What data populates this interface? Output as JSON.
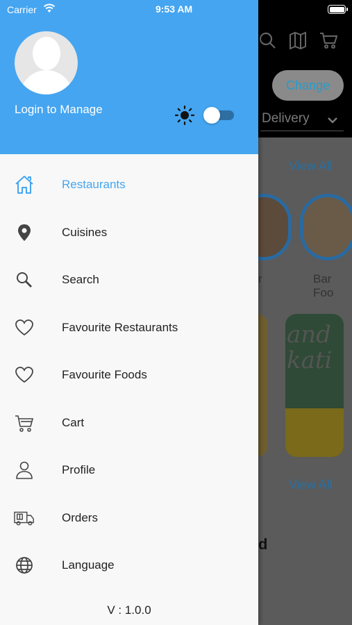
{
  "status_bar": {
    "carrier": "Carrier",
    "time": "9:53 AM"
  },
  "background": {
    "change_button": "Change",
    "delivery": "Delivery",
    "view_all": "View All",
    "label_partial_1": "r",
    "label_partial_2": "Bar Foo",
    "card_text": "and\nkati",
    "section_partial": "d"
  },
  "drawer": {
    "login_label": "Login to Manage",
    "theme_toggle": "off",
    "menu": [
      {
        "label": "Restaurants",
        "icon": "home-icon",
        "active": true
      },
      {
        "label": "Cuisines",
        "icon": "location-pin-icon",
        "active": false
      },
      {
        "label": "Search",
        "icon": "search-icon",
        "active": false
      },
      {
        "label": "Favourite Restaurants",
        "icon": "heart-icon",
        "active": false
      },
      {
        "label": "Favourite Foods",
        "icon": "heart-icon",
        "active": false
      },
      {
        "label": "Cart",
        "icon": "cart-icon",
        "active": false
      },
      {
        "label": "Profile",
        "icon": "profile-icon",
        "active": false
      },
      {
        "label": "Orders",
        "icon": "delivery-truck-icon",
        "active": false
      },
      {
        "label": "Language",
        "icon": "globe-icon",
        "active": false
      }
    ],
    "version": "V : 1.0.0"
  },
  "colors": {
    "accent": "#45a5f0",
    "header_bg": "#45a5f0",
    "drawer_bg": "#f8f8f8"
  }
}
